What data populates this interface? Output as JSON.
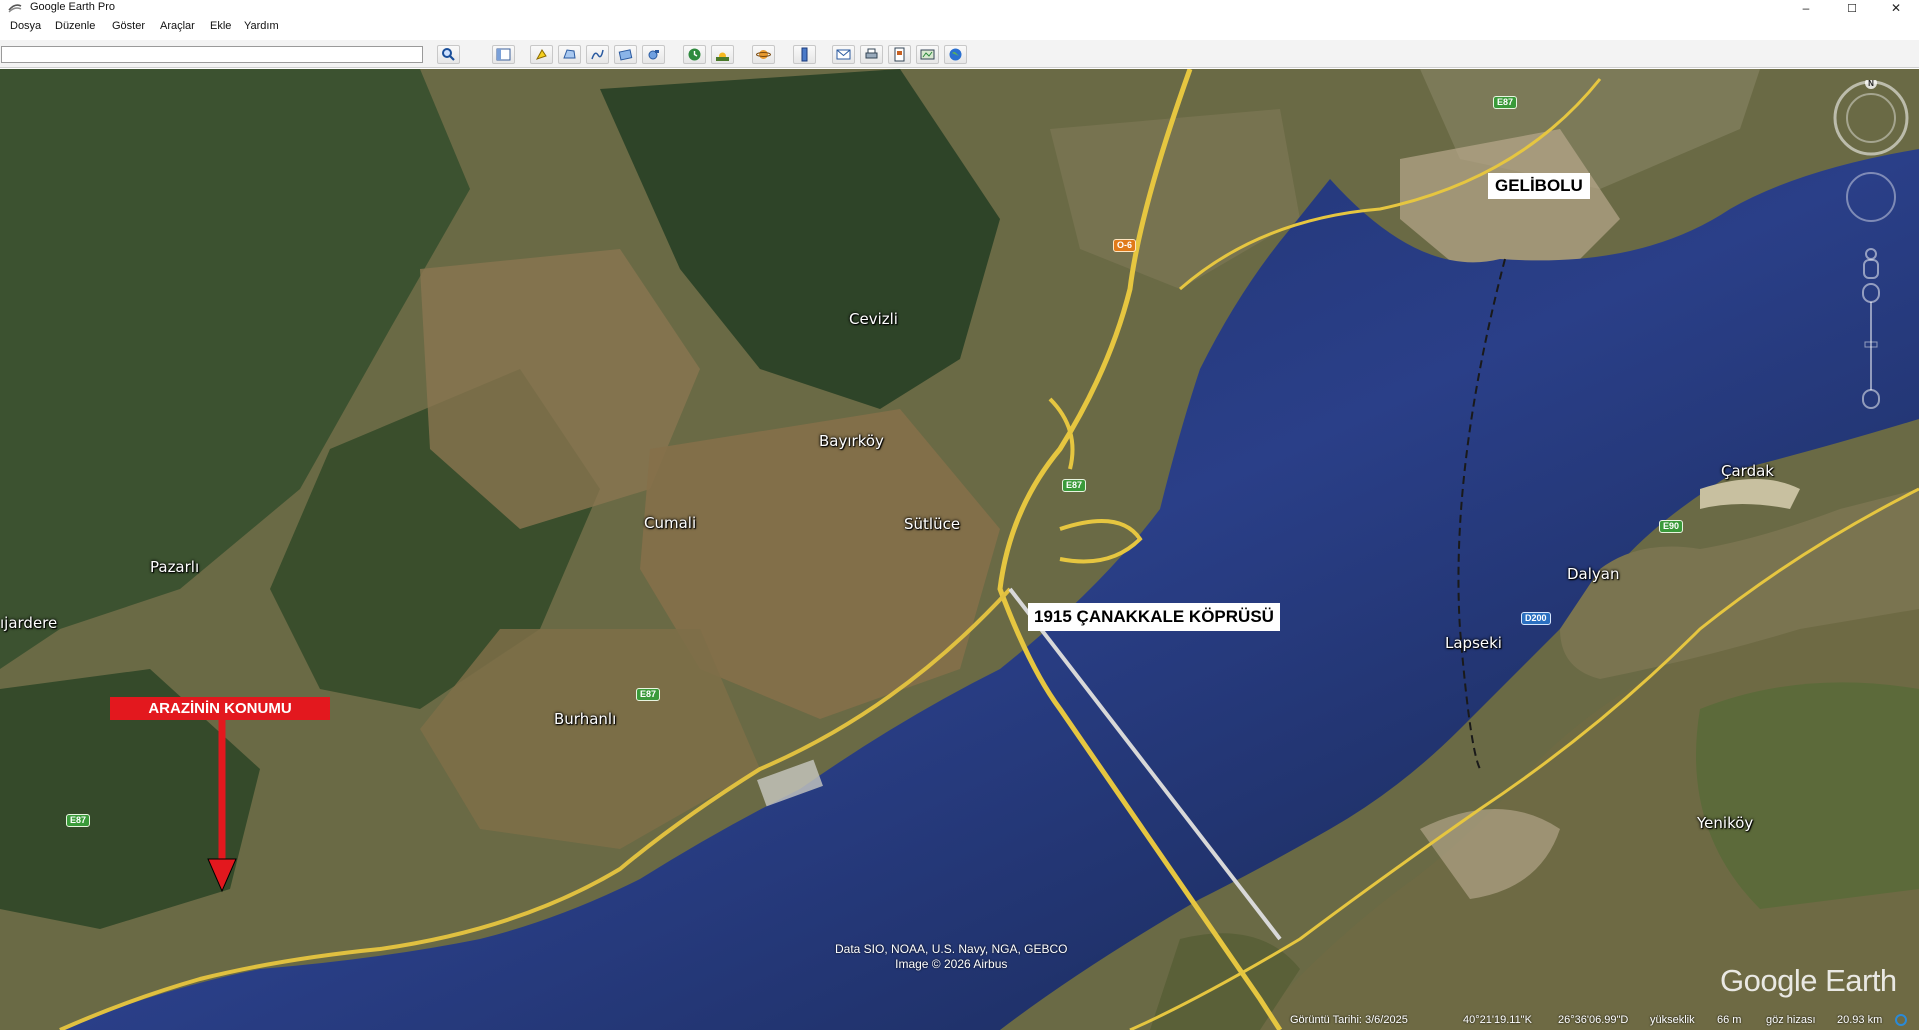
{
  "window": {
    "title": "Google Earth Pro",
    "minimize": "–",
    "maximize": "☐",
    "close": "✕"
  },
  "menu": [
    {
      "label": "Dosya"
    },
    {
      "label": "Düzenle"
    },
    {
      "label": "Göster"
    },
    {
      "label": "Araçlar"
    },
    {
      "label": "Ekle"
    },
    {
      "label": "Yardım"
    }
  ],
  "search": {
    "value": "",
    "placeholder": ""
  },
  "toolbar_icons": [
    "search-icon",
    "sidebar-toggle-icon",
    "placemark-icon",
    "polygon-icon",
    "path-icon",
    "image-overlay-icon",
    "record-tour-icon",
    "historical-imagery-icon",
    "sunlight-icon",
    "planets-icon",
    "ruler-icon",
    "email-icon",
    "print-icon",
    "save-image-icon",
    "view-in-maps-icon",
    "earth-icon"
  ],
  "places": {
    "cevizli": "Cevizli",
    "bayirkoy": "Bayırköy",
    "cumali": "Cumali",
    "sutluce": "Sütlüce",
    "pazarli": "Pazarlı",
    "gardere": "ıjardere",
    "burhanli": "Burhanlı",
    "cardak": "Çardak",
    "dalyan": "Dalyan",
    "lapseki": "Lapseki",
    "yenikoy": "Yeniköy"
  },
  "roads": {
    "e87_top": "E87",
    "o6": "O-6",
    "e87_mid": "E87",
    "e87_low": "E87",
    "e87_bottom": "E87",
    "e90": "E90",
    "d200": "D200"
  },
  "annotations": {
    "gelibolu": "GELİBOLU",
    "bridge": "1915 ÇANAKKALE KÖPRÜSÜ",
    "location": "ARAZİNİN KONUMU"
  },
  "attribution": {
    "line1": "Data SIO, NOAA, U.S. Navy, NGA, GEBCO",
    "line2": "Image © 2026 Airbus"
  },
  "logo": "Google Earth",
  "status": {
    "date_label": "Görüntü Tarihi: 3/6/2025",
    "lat": "40°21'19.11\"K",
    "lon": "26°36'06.99\"D",
    "elev_label": "yükseklik",
    "elev_value": "66 m",
    "eye_label": "göz hizası",
    "eye_value": "20.93 km"
  },
  "colors": {
    "water": "#1a2a5c",
    "land": "#5a6a3a",
    "road": "#e8c840",
    "marker": "#e3181e"
  }
}
